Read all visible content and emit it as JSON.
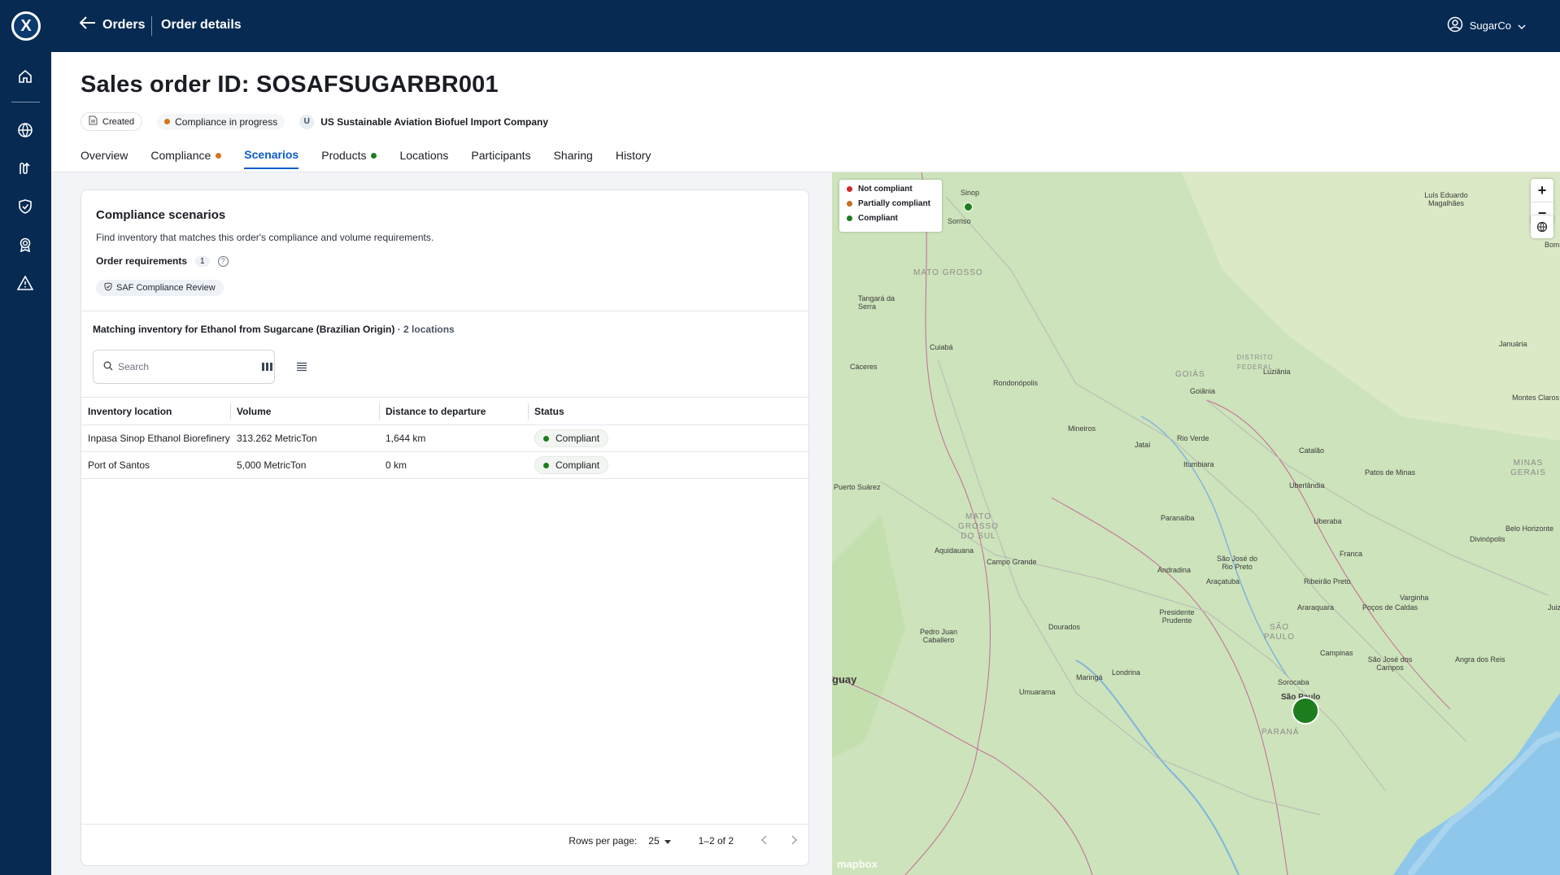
{
  "topbar": {
    "logo": "X",
    "back_label": "Orders",
    "crumb_current": "Order details",
    "user_name": "SugarCo"
  },
  "sidebar": {
    "icons": [
      "home-icon",
      "globe-icon",
      "route-icon",
      "shield-icon",
      "award-icon",
      "warning-icon"
    ]
  },
  "header": {
    "title": "Sales order ID: SOSAFSUGARBR001",
    "status_created": "Created",
    "status_compliance": "Compliance in progress",
    "company_initial": "U",
    "company_name": "US Sustainable Aviation Biofuel Import Company",
    "tabs": [
      {
        "label": "Overview"
      },
      {
        "label": "Compliance",
        "dot": "#d4761a"
      },
      {
        "label": "Scenarios",
        "active": true
      },
      {
        "label": "Products",
        "dot": "#1e7d1e"
      },
      {
        "label": "Locations"
      },
      {
        "label": "Participants"
      },
      {
        "label": "Sharing"
      },
      {
        "label": "History"
      }
    ]
  },
  "scenarios": {
    "title": "Compliance scenarios",
    "description": "Find inventory that matches this order's compliance and volume requirements.",
    "requirements_label": "Order requirements",
    "requirements_count": "1",
    "requirement_chip": "SAF Compliance Review",
    "match_title": "Matching inventory for Ethanol from Sugarcane (Brazilian Origin)",
    "match_locations": "· 2 locations",
    "search_placeholder": "Search",
    "columns": [
      "Inventory location",
      "Volume",
      "Distance to departure",
      "Status"
    ],
    "rows": [
      {
        "location": "Inpasa Sinop Ethanol Biorefinery",
        "volume": "313.262 MetricTon",
        "distance": "1,644 km",
        "status": "Compliant"
      },
      {
        "location": "Port of Santos",
        "volume": "5,000 MetricTon",
        "distance": "0 km",
        "status": "Compliant"
      }
    ],
    "rows_per_page_label": "Rows per page:",
    "rows_per_page": "25",
    "range": "1–2 of 2"
  },
  "map": {
    "legend": [
      {
        "label": "Not compliant",
        "color": "#d42a2a"
      },
      {
        "label": "Partially compliant",
        "color": "#c2701d"
      },
      {
        "label": "Compliant",
        "color": "#1e7d1e"
      }
    ],
    "zoom_in": "+",
    "zoom_out": "−",
    "attribution": "mapbox",
    "places": [
      "Sinop",
      "Sorriso",
      "Luís Eduardo Magalhães",
      "Tangará da Serra",
      "Cuiabá",
      "Cáceres",
      "Rondonópolis",
      "Goiânia",
      "Luziânia",
      "Mineiros",
      "Jataí",
      "Rio Verde",
      "Itumbiara",
      "Catalão",
      "Patos de Minas",
      "Puerto Suárez",
      "Uberlândia",
      "Paranaíba",
      "Uberaba",
      "Franca",
      "Aquidauana",
      "Campo Grande",
      "Andradina",
      "São José do Rio Preto",
      "Araçatuba",
      "Ribeirão Preto",
      "Varginha",
      "Poços de Caldas",
      "Presidente Prudente",
      "Araraquara",
      "Dourados",
      "Pedro Juan Caballero",
      "Campinas",
      "São José dos Campos",
      "Angra dos Reis",
      "Maringá",
      "Londrina",
      "Umuarama",
      "Sorocaba",
      "São Paulo",
      "Januária",
      "Montes Claros",
      "Belo Horizonte",
      "Divinópolis",
      "Juiz",
      "Bom",
      "guay"
    ],
    "states": [
      "MATO GROSSO",
      "GOIÁS",
      "DISTRITO FEDERAL",
      "MATO GROSSO DO SUL",
      "MINAS GERAIS",
      "SÃO PAULO",
      "PARANÁ"
    ]
  }
}
